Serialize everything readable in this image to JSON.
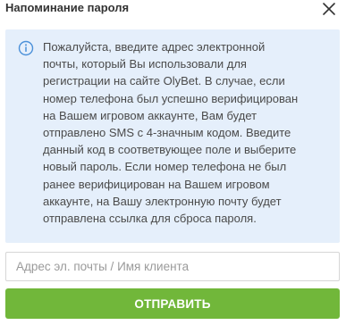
{
  "dialog": {
    "title": "Напоминание пароля",
    "close_icon": "close-icon"
  },
  "info": {
    "icon": "info-circle-icon",
    "text": "Пожалуйста, введите адрес электронной\nпочты, который Вы использовали для\nрегистрации на сайте OlyBet. В случае, если\nномер телефона был успешно верифицирован\nна Вашем игровом аккаунте, Вам будет\nотправлено SMS с 4-значным кодом. Введите\nданный код в соответвующее поле и выберите\nновый пароль. Если номер телефона не был\nранее верифицирован на Вашем игровом\nаккаунте, на Вашу электронную почту будет\nотправлена ссылка для сброса пароля."
  },
  "form": {
    "email_placeholder": "Адрес эл. почты / Имя клиента",
    "email_value": "",
    "submit_label": "ОТПРАВИТЬ"
  },
  "colors": {
    "info_background": "#e5effb",
    "info_icon": "#4a90d9",
    "submit_background": "#71b73a",
    "title_text": "#333333"
  }
}
